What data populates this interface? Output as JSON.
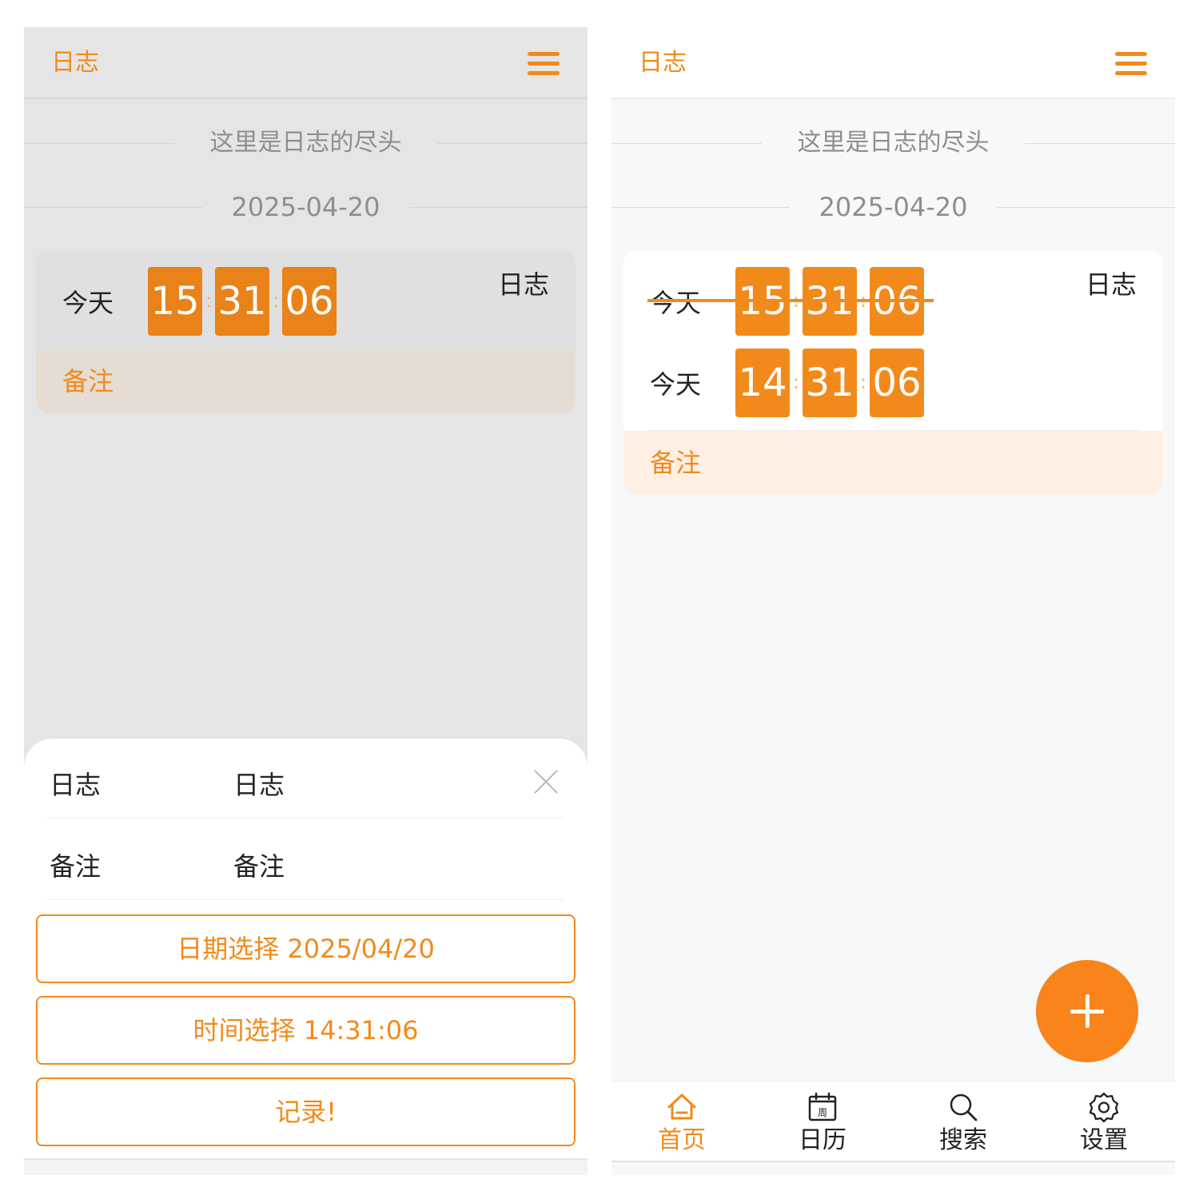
{
  "app": {
    "title": "日志",
    "divider_end": "这里是日志的尽头",
    "divider_date": "2025-04-20"
  },
  "left": {
    "entry": {
      "day": "今天",
      "hh": "15",
      "mm": "31",
      "ss": "06",
      "title": "日志",
      "note": "备注"
    },
    "sheet": {
      "title_label": "日志",
      "title_value": "日志",
      "note_label": "备注",
      "note_value": "备注",
      "date_button": "日期选择 2025/04/20",
      "time_button": "时间选择 14:31:06",
      "record_button": "记录!"
    }
  },
  "right": {
    "entry": {
      "old_day": "今天",
      "old_hh": "15",
      "old_mm": "31",
      "old_ss": "06",
      "new_day": "今天",
      "new_hh": "14",
      "new_mm": "31",
      "new_ss": "06",
      "title": "日志",
      "note": "备注"
    },
    "tabs": [
      {
        "label": "首页",
        "icon": "home-icon",
        "active": true
      },
      {
        "label": "日历",
        "icon": "calendar-week-icon",
        "active": false
      },
      {
        "label": "搜索",
        "icon": "search-icon",
        "active": false
      },
      {
        "label": "设置",
        "icon": "settings-gear-icon",
        "active": false
      }
    ],
    "calendar_icon_glyph": "周"
  },
  "colors": {
    "accent": "#f28a1b",
    "note_background": "#fff0e3",
    "overlay_background": "#e4e5e6",
    "page_background": "#f7f8fa"
  }
}
